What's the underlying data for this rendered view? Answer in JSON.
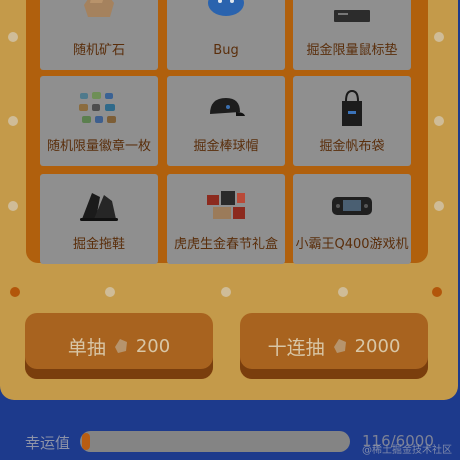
{
  "prizes": [
    {
      "label": "随机矿石",
      "icon": "ore-icon"
    },
    {
      "label": "Bug",
      "icon": "bug-plush-icon"
    },
    {
      "label": "掘金限量鼠标垫",
      "icon": "mousepad-icon"
    },
    {
      "label": "随机限量徽章一枚",
      "icon": "badges-icon"
    },
    {
      "label": "掘金棒球帽",
      "icon": "cap-icon"
    },
    {
      "label": "掘金帆布袋",
      "icon": "tote-bag-icon"
    },
    {
      "label": "掘金拖鞋",
      "icon": "slippers-icon"
    },
    {
      "label": "虎虎生金春节礼盒",
      "icon": "gift-box-icon"
    },
    {
      "label": "小霸王Q400游戏机",
      "icon": "game-console-icon"
    }
  ],
  "buttons": {
    "single": {
      "label": "单抽",
      "cost": "200"
    },
    "ten": {
      "label": "十连抽",
      "cost": "2000"
    }
  },
  "luck": {
    "label": "幸运值",
    "value": "116/6000",
    "fraction": 0.0193
  },
  "watermark": "@稀土掘金技术社区",
  "colors": {
    "board": "#b0600d",
    "frame": "#c49a4a",
    "background": "#1d3a8c"
  }
}
